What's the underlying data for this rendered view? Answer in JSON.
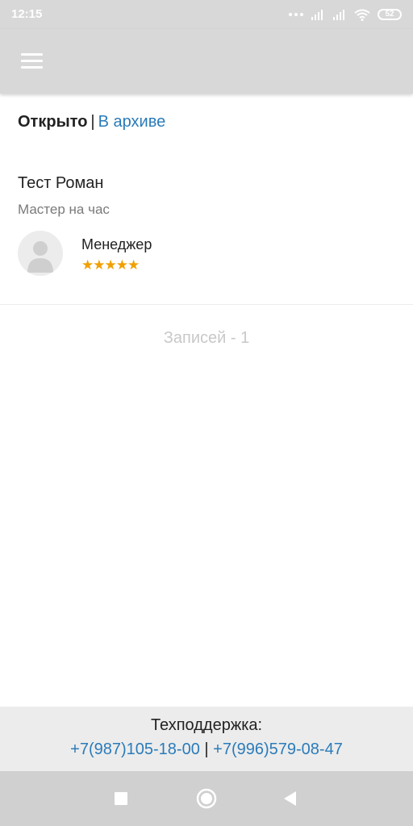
{
  "status_bar": {
    "time": "12:15",
    "battery": "52",
    "icons": [
      "more-dots-icon",
      "signal-icon",
      "signal-icon",
      "wifi-icon",
      "battery-icon"
    ]
  },
  "app_bar": {
    "menu_icon": "hamburger-menu-icon"
  },
  "filter": {
    "active_label": "Открыто",
    "separator": "|",
    "archive_label": "В архиве"
  },
  "card": {
    "title": "Тест Роман",
    "subtitle": "Мастер на час",
    "role": "Менеджер",
    "rating": {
      "value": 5,
      "max": 5,
      "stars_text": "★★★★★"
    },
    "star_color": "#f0a000",
    "avatar_icon": "user-placeholder-icon"
  },
  "records_text": "Записей - 1",
  "footer": {
    "label": "Техподдержка:",
    "phone1": "+7(987)105-18-00",
    "separator": "|",
    "phone2": "+7(996)579-08-47"
  },
  "nav_bar": {
    "icons": [
      "recents-square-icon",
      "home-circle-icon",
      "back-triangle-icon"
    ]
  },
  "colors": {
    "link": "#2b7bb9",
    "header_bg": "#d8d8d8",
    "footer_bg": "#ececec"
  }
}
